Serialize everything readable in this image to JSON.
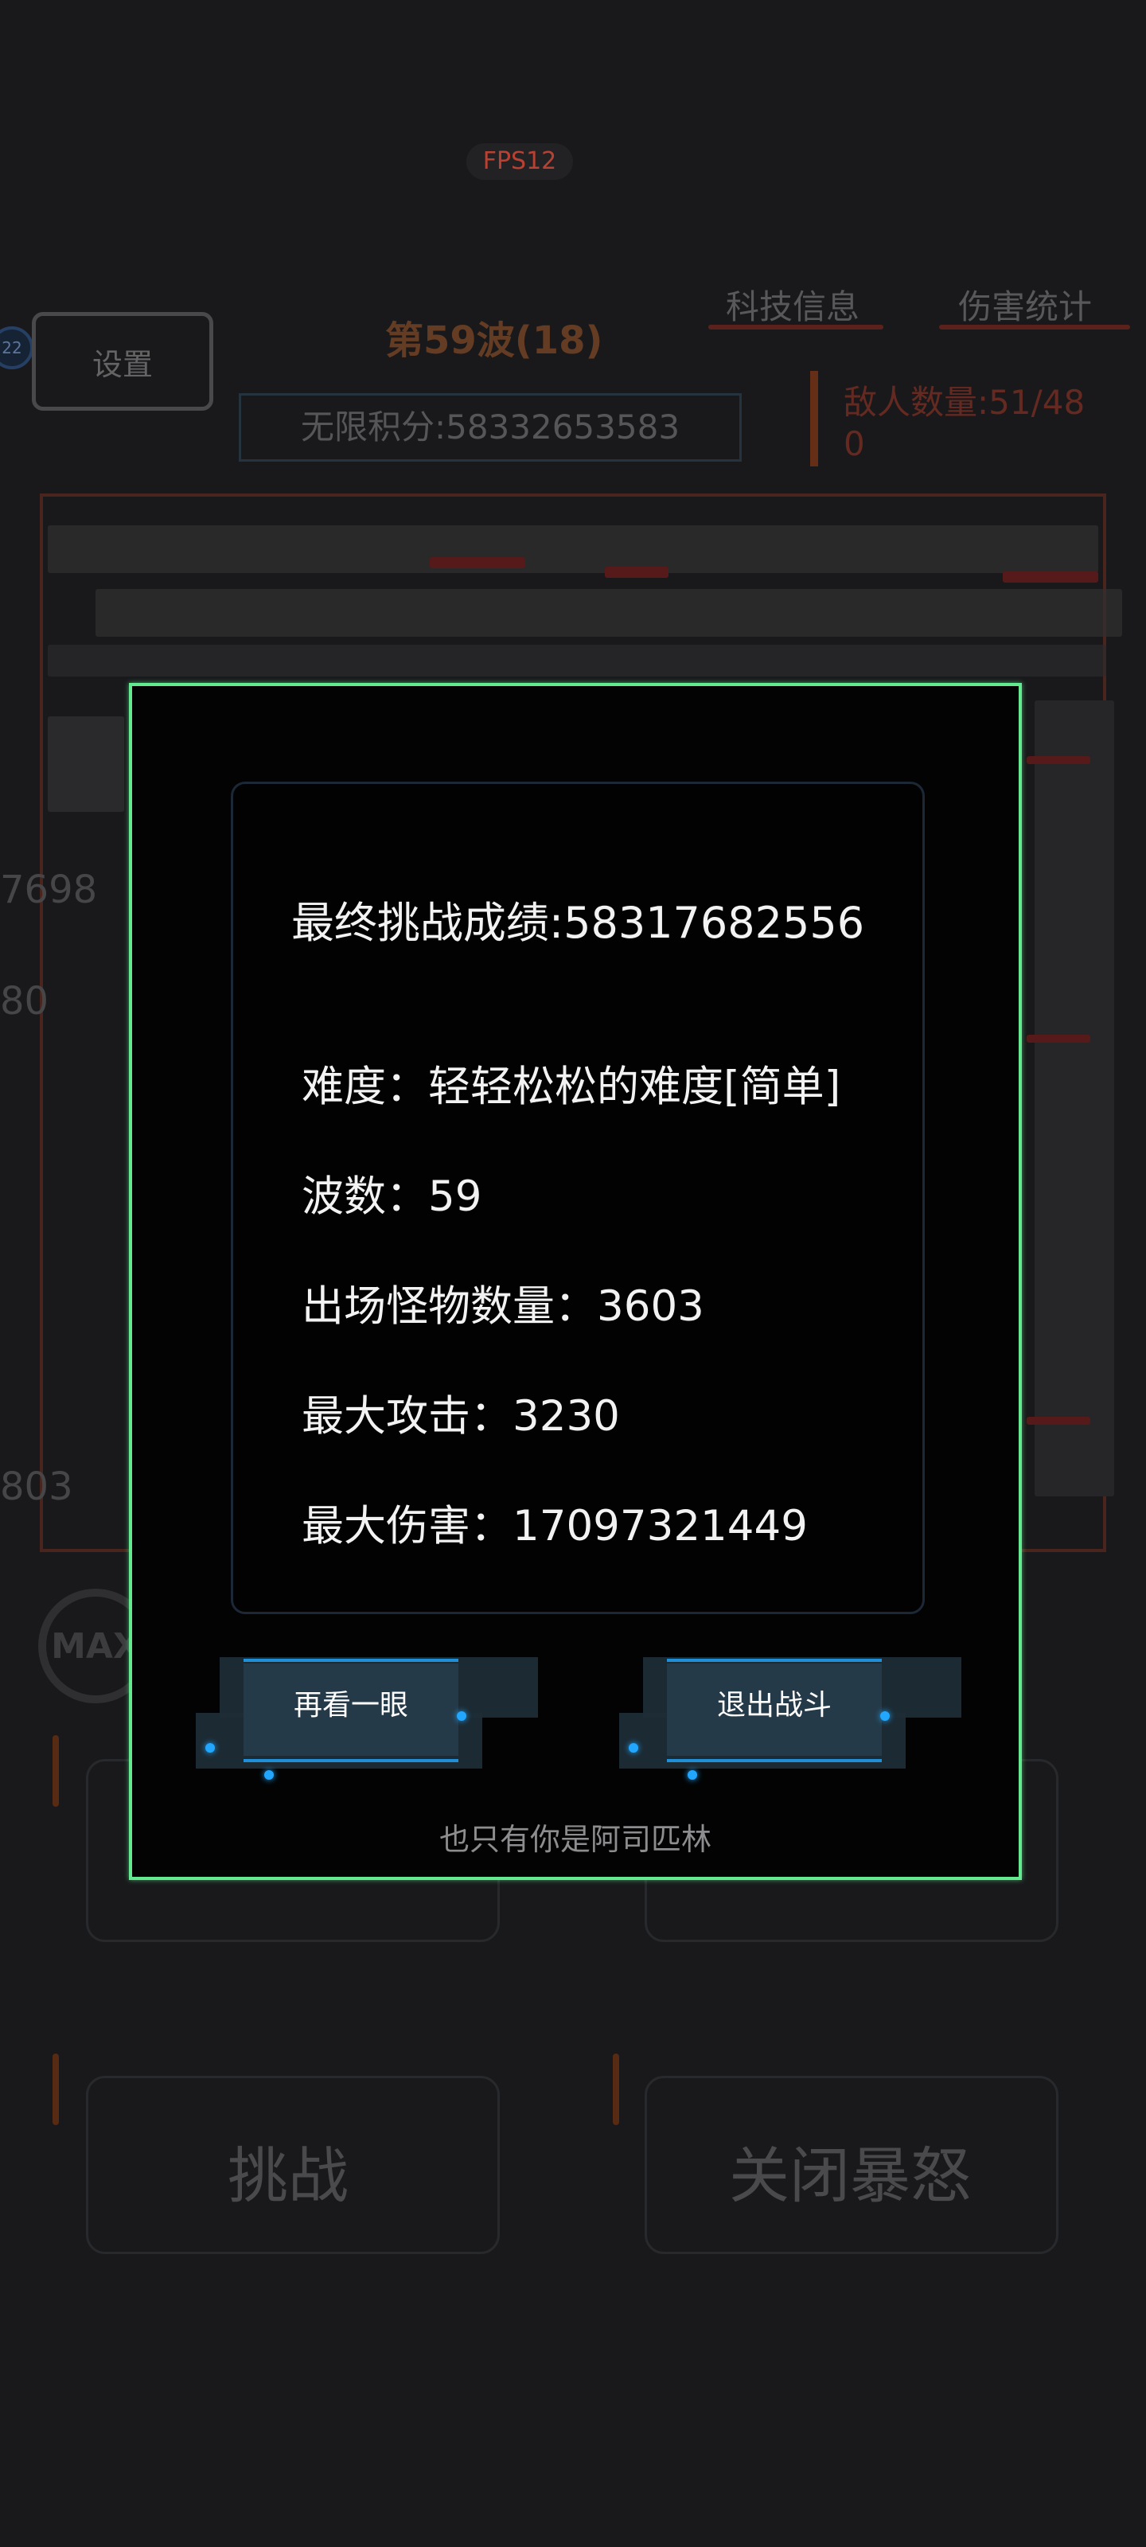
{
  "hud": {
    "fps": "FPS12",
    "tech_info_tab": "科技信息",
    "damage_stats_tab": "伤害统计",
    "settings_button": "设置",
    "avatar_level": "22",
    "wave_title": "第59波(18)",
    "infinite_score": "无限积分:58332653583",
    "enemy_count": "敌人数量:51/48",
    "enemy_count_sub": "0",
    "max_badge": "MAX",
    "challenge_button": "挑战",
    "close_rage_button": "关闭暴怒"
  },
  "result_modal": {
    "final_score": "最终挑战成绩:58317682556",
    "difficulty": "难度：轻轻松松的难度[简单]",
    "waves": "波数：59",
    "monster_count": "出场怪物数量：3603",
    "max_attack": "最大攻击：3230",
    "max_damage": "最大伤害：17097321449",
    "review_button": "再看一眼",
    "exit_button": "退出战斗",
    "footer": "也只有你是阿司匹林"
  },
  "colors": {
    "modal_border": "#63e98f",
    "button_accent": "#21a7ff",
    "fps_text": "#e0503f"
  }
}
